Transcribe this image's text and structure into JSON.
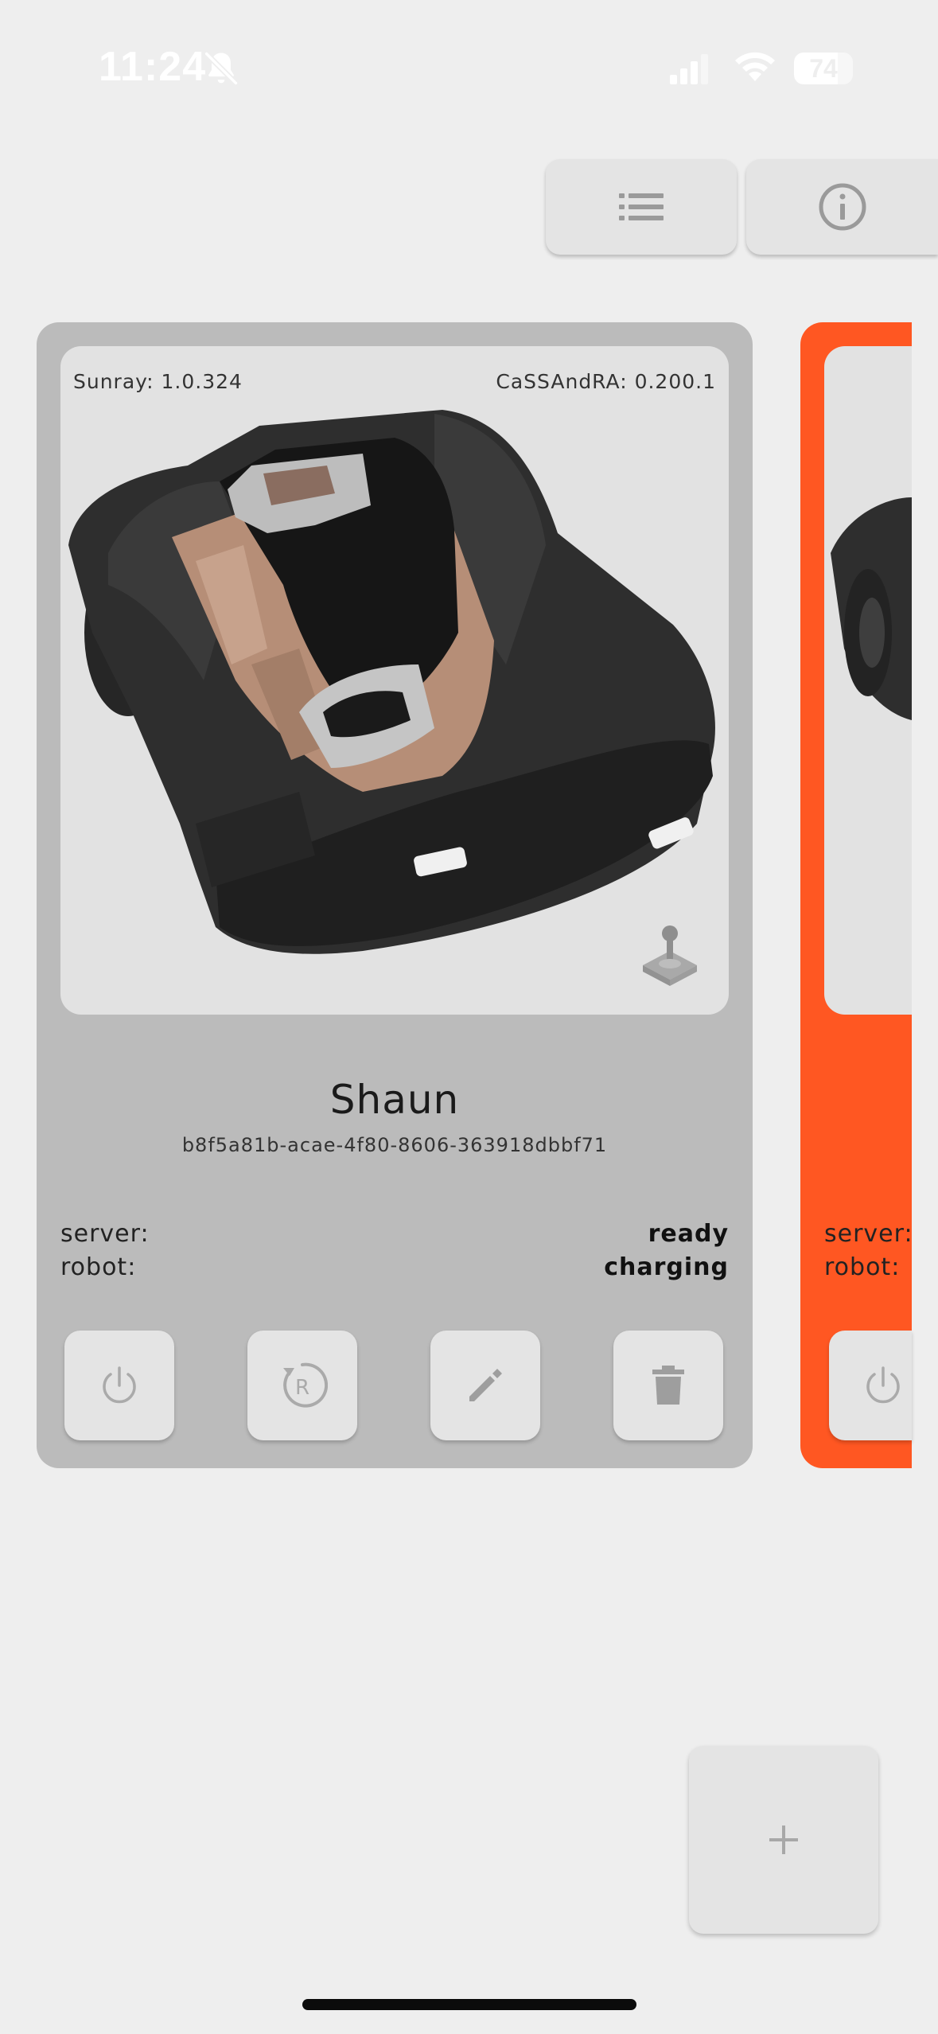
{
  "status_bar": {
    "time": "11:24",
    "battery_level": "74",
    "battery_fraction": 0.74,
    "icons": [
      "bell-off-icon",
      "cellular-signal-icon",
      "wifi-icon",
      "battery-icon"
    ]
  },
  "toolbar": {
    "icons": [
      "list-icon",
      "info-icon"
    ]
  },
  "robots": [
    {
      "firmware_left": "Sunray: 1.0.324",
      "firmware_right": "CaSSAndRA: 0.200.1",
      "name": "Shaun",
      "id": "b8f5a81b-acae-4f80-8606-363918dbbf71",
      "server_label": "server:",
      "server_status": "ready",
      "robot_label": "robot:",
      "robot_status": "charging",
      "card_color": "#bbbbbb",
      "actions": [
        "power-icon",
        "restart-icon",
        "edit-icon",
        "delete-icon"
      ]
    },
    {
      "server_label": "server:",
      "robot_label": "robot:",
      "card_color": "#ff5722"
    }
  ],
  "fab": {
    "icon": "plus-icon"
  }
}
